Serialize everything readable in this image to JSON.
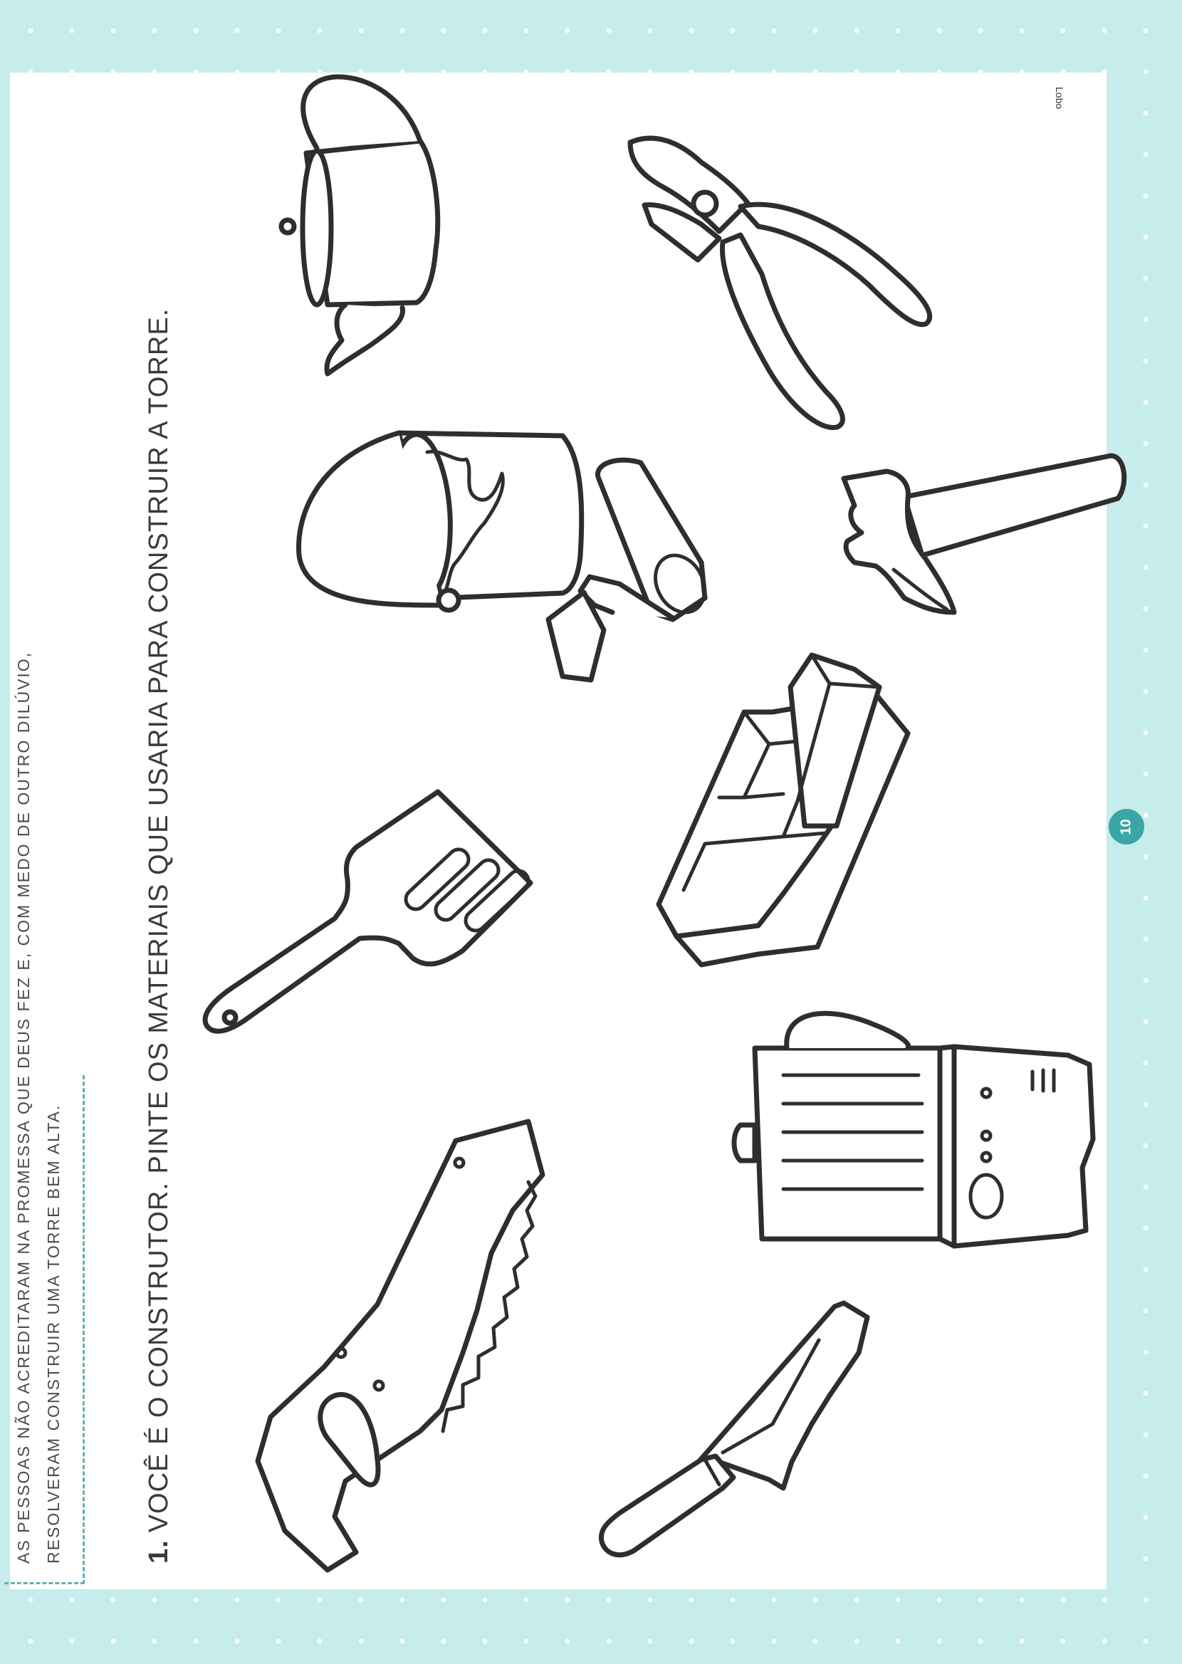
{
  "intro": {
    "line1": "AS PESSOAS NÃO ACREDITARAM NA PROMESSA QUE DEUS FEZ E, COM MEDO DE OUTRO DILÚVIO,",
    "line2": "RESOLVERAM CONSTRUIR UMA TORRE BEM ALTA."
  },
  "question": {
    "number": "1.",
    "text": "VOCÊ É O CONSTRUTOR. PINTE OS MATERIAIS QUE USARIA PARA CONSTRUIR A TORRE."
  },
  "publisher": "Lobo",
  "page_number": "10",
  "illustrations": [
    {
      "name": "saw-icon"
    },
    {
      "name": "trowel-icon"
    },
    {
      "name": "spatula-icon"
    },
    {
      "name": "blender-icon"
    },
    {
      "name": "bricks-icon"
    },
    {
      "name": "paint-bucket-icon"
    },
    {
      "name": "paint-roller-icon"
    },
    {
      "name": "hammer-icon"
    },
    {
      "name": "teapot-icon"
    },
    {
      "name": "pliers-icon"
    }
  ],
  "colors": {
    "background": "#c6ecec",
    "accent": "#3aa6a6",
    "dash": "#5fb3b3",
    "line_art": "#2e2e2e"
  }
}
